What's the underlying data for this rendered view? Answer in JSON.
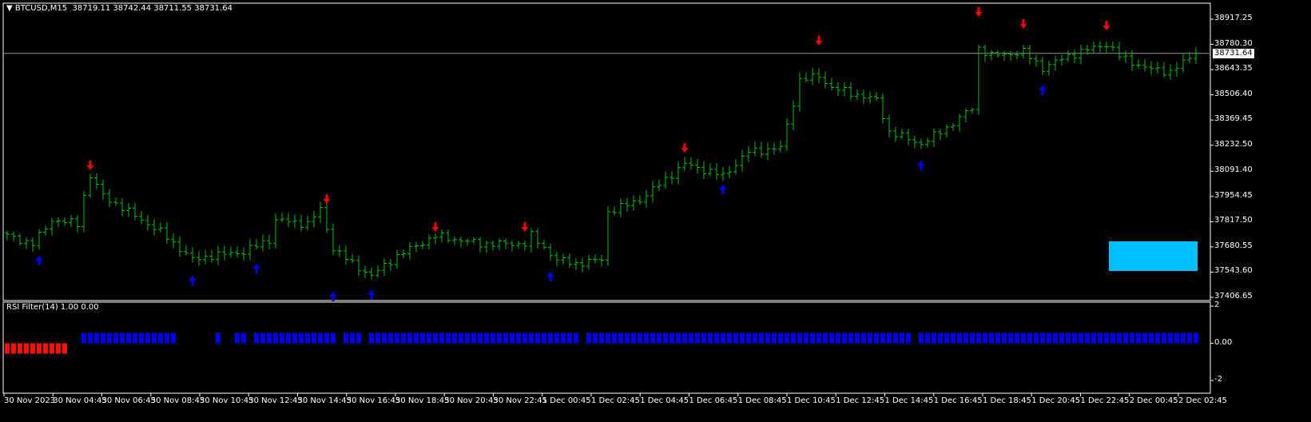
{
  "header": {
    "symbol": "BTCUSD,M15",
    "open": "38719.11",
    "high": "38742.44",
    "low": "38711.55",
    "close": "38731.64"
  },
  "indicator": {
    "title": "RSI Filter(14) 1.00 0.00",
    "axis_labels": [
      "2",
      "0.00",
      "-2"
    ]
  },
  "current_price": "38731.64",
  "colors": {
    "bars": "#00c000",
    "down_arrow": "#ff0000",
    "up_arrow": "#0000ff",
    "rect": "#00bfff",
    "ind_pos": "#0000f0",
    "ind_neg": "#ff1010",
    "price_line": "#8a9a8a"
  },
  "chart_data": {
    "type": "ohlc",
    "title": "BTCUSD,M15",
    "bar_count": 187,
    "ylim": [
      37406.65,
      38917.25
    ],
    "price_axis_labels": [
      "38917.25",
      "38780.30",
      "38643.35",
      "38506.40",
      "38369.45",
      "38232.50",
      "38091.40",
      "37954.45",
      "37817.50",
      "37680.55",
      "37543.60",
      "37406.65"
    ],
    "time_axis_labels": [
      "30 Nov 2023",
      "30 Nov 04:45",
      "30 Nov 06:45",
      "30 Nov 08:45",
      "30 Nov 10:45",
      "30 Nov 12:45",
      "30 Nov 14:45",
      "30 Nov 16:45",
      "30 Nov 18:45",
      "30 Nov 20:45",
      "30 Nov 22:45",
      "1 Dec 00:45",
      "1 Dec 02:45",
      "1 Dec 04:45",
      "1 Dec 06:45",
      "1 Dec 08:45",
      "1 Dec 10:45",
      "1 Dec 12:45",
      "1 Dec 14:45",
      "1 Dec 16:45",
      "1 Dec 18:45",
      "1 Dec 20:45",
      "1 Dec 22:45",
      "2 Dec 00:45",
      "2 Dec 02:45"
    ],
    "close_waypoints": [
      [
        0,
        37741
      ],
      [
        4,
        37697
      ],
      [
        7,
        37827
      ],
      [
        11,
        37806
      ],
      [
        12,
        37958
      ],
      [
        13,
        38066
      ],
      [
        15,
        37958
      ],
      [
        19,
        37871
      ],
      [
        24,
        37762
      ],
      [
        29,
        37611
      ],
      [
        32,
        37632
      ],
      [
        37,
        37654
      ],
      [
        41,
        37719
      ],
      [
        42,
        37827
      ],
      [
        47,
        37806
      ],
      [
        49,
        37884
      ],
      [
        51,
        37675
      ],
      [
        54,
        37589
      ],
      [
        57,
        37524
      ],
      [
        61,
        37632
      ],
      [
        67,
        37741
      ],
      [
        74,
        37697
      ],
      [
        81,
        37697
      ],
      [
        82,
        37741
      ],
      [
        86,
        37611
      ],
      [
        89,
        37589
      ],
      [
        93,
        37611
      ],
      [
        94,
        37871
      ],
      [
        99,
        37936
      ],
      [
        106,
        38131
      ],
      [
        112,
        38066
      ],
      [
        116,
        38197
      ],
      [
        121,
        38218
      ],
      [
        124,
        38587
      ],
      [
        127,
        38609
      ],
      [
        129,
        38544
      ],
      [
        136,
        38479
      ],
      [
        138,
        38305
      ],
      [
        143,
        38240
      ],
      [
        147,
        38327
      ],
      [
        151,
        38435
      ],
      [
        152,
        38761
      ],
      [
        154,
        38718
      ],
      [
        159,
        38739
      ],
      [
        162,
        38652
      ],
      [
        166,
        38718
      ],
      [
        172,
        38783
      ],
      [
        174,
        38718
      ],
      [
        178,
        38652
      ],
      [
        182,
        38631
      ],
      [
        186,
        38731.64
      ]
    ],
    "down_arrows": [
      [
        13,
        38119
      ],
      [
        50,
        37936
      ],
      [
        67,
        37784
      ],
      [
        81,
        37784
      ],
      [
        106,
        38214
      ],
      [
        127,
        38796
      ],
      [
        152,
        38952
      ],
      [
        159,
        38887
      ],
      [
        172,
        38878
      ]
    ],
    "up_arrows": [
      [
        5,
        37611
      ],
      [
        29,
        37502
      ],
      [
        39,
        37567
      ],
      [
        51,
        37415
      ],
      [
        57,
        37424
      ],
      [
        85,
        37524
      ],
      [
        112,
        37997
      ],
      [
        143,
        38127
      ],
      [
        162,
        38535
      ]
    ],
    "rectangle": {
      "bar_from": 173,
      "bar_to": 186,
      "price_top": 37711,
      "price_bottom": 37550
    },
    "indicator_runs": [
      [
        0,
        9,
        -1
      ],
      [
        12,
        26,
        1
      ],
      [
        33,
        33,
        1
      ],
      [
        36,
        37,
        1
      ],
      [
        39,
        51,
        1
      ],
      [
        53,
        55,
        1
      ],
      [
        57,
        89,
        1
      ],
      [
        91,
        141,
        1
      ],
      [
        143,
        186,
        1
      ]
    ],
    "indicator_ylim": [
      -2,
      2
    ]
  }
}
